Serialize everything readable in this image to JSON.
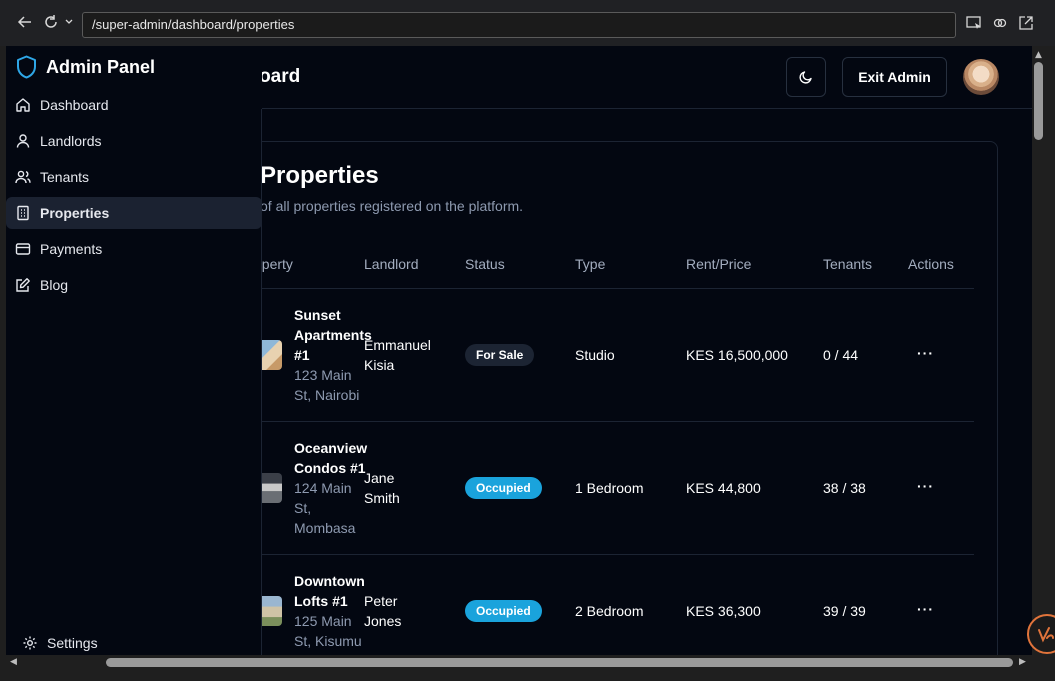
{
  "browser": {
    "url": "/super-admin/dashboard/properties"
  },
  "sidebar": {
    "brand": "Admin Panel",
    "items": [
      {
        "label": "Dashboard",
        "icon": "home-icon",
        "active": false
      },
      {
        "label": "Landlords",
        "icon": "user-icon",
        "active": false
      },
      {
        "label": "Tenants",
        "icon": "users-icon",
        "active": false
      },
      {
        "label": "Properties",
        "icon": "building-icon",
        "active": true
      },
      {
        "label": "Payments",
        "icon": "credit-card-icon",
        "active": false
      },
      {
        "label": "Blog",
        "icon": "edit-icon",
        "active": false
      }
    ],
    "settings_label": "Settings"
  },
  "header": {
    "title": "Dashboard",
    "exit_label": "Exit Admin"
  },
  "page": {
    "title": "Properties",
    "subtitle": "of all properties registered on the platform."
  },
  "table": {
    "columns": [
      "operty",
      "Landlord",
      "Status",
      "Type",
      "Rent/Price",
      "Tenants",
      "Actions"
    ],
    "rows": [
      {
        "name": "Sunset Apartments #1",
        "address": "123 Main St, Nairobi",
        "landlord": "Emmanuel Kisia",
        "status": "For Sale",
        "type": "Studio",
        "price": "KES 16,500,000",
        "tenants": "0 / 44",
        "actions": "···"
      },
      {
        "name": "Oceanview Condos #1",
        "address": "124 Main St, Mombasa",
        "landlord": "Jane Smith",
        "status": "Occupied",
        "type": "1 Bedroom",
        "price": "KES 44,800",
        "tenants": "38 / 38",
        "actions": "···"
      },
      {
        "name": "Downtown Lofts #1",
        "address": "125 Main St, Kisumu",
        "landlord": "Peter Jones",
        "status": "Occupied",
        "type": "2 Bedroom",
        "price": "KES 36,300",
        "tenants": "39 / 39",
        "actions": "···"
      }
    ]
  },
  "colors": {
    "background": "#030711",
    "accent_badge": "#1aa3dc",
    "muted_text": "#8e9ab0",
    "border": "#1c2433"
  }
}
